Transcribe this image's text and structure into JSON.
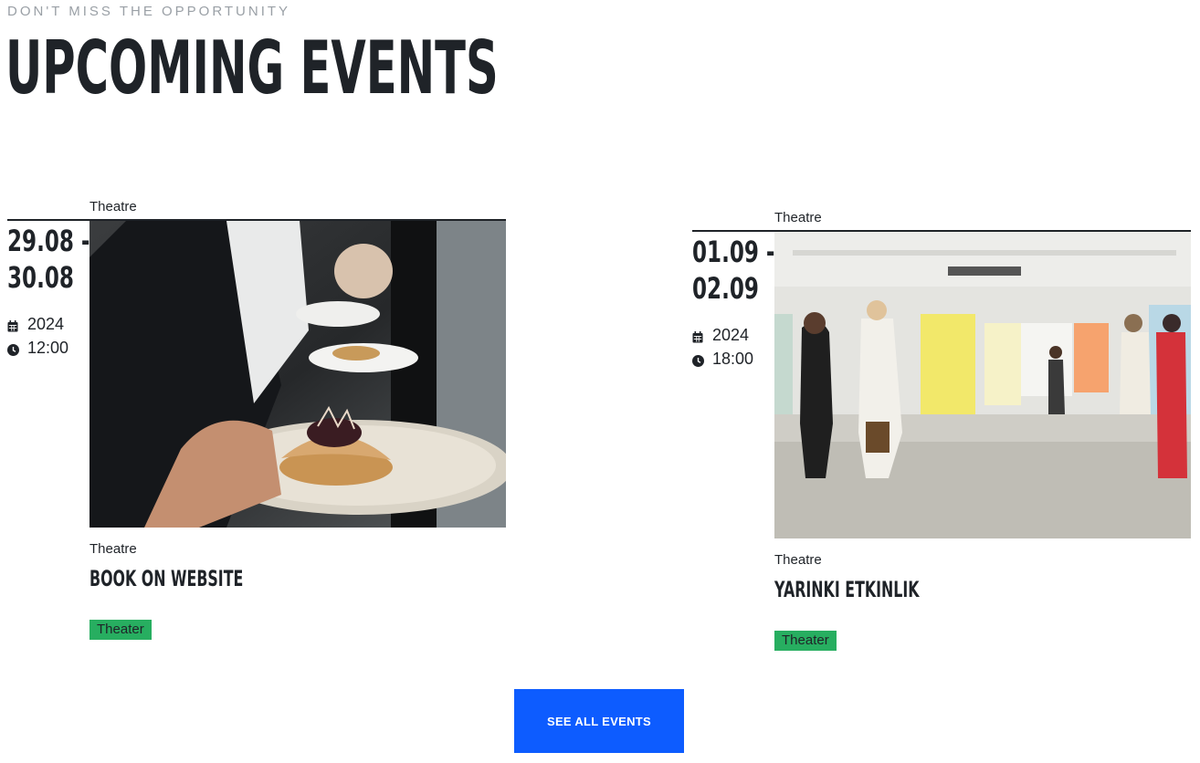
{
  "section": {
    "eyebrow": "DON'T MISS THE OPPORTUNITY",
    "title": "UPCOMING EVENTS"
  },
  "events": [
    {
      "top_category": "Theatre",
      "date_range": "29.08 - 30.08",
      "date_line_1": "29.08 -",
      "date_line_2": "30.08",
      "year": "2024",
      "time": "12:00",
      "image_subject": "Waiter serving plated tart dishes in a restaurant",
      "category": "Theatre",
      "title": "BOOK ON WEBSITE",
      "tag": "Theater"
    },
    {
      "top_category": "Theatre",
      "date_range": "01.09 - 02.09",
      "date_line_1": "01.09 -",
      "date_line_2": "02.09",
      "year": "2024",
      "time": "18:00",
      "image_subject": "Visitors in a bright white art gallery",
      "category": "Theatre",
      "title": "YARINKI ETKINLIK",
      "tag": "Theater"
    }
  ],
  "cta": {
    "label": "SEE ALL EVENTS"
  },
  "icons": {
    "date": "calendar-icon",
    "time": "clock-icon"
  },
  "colors": {
    "tag_bg": "#27ae60",
    "cta_bg": "#0d5cff",
    "text": "#1f2328",
    "eyebrow": "#9aa0a6"
  }
}
